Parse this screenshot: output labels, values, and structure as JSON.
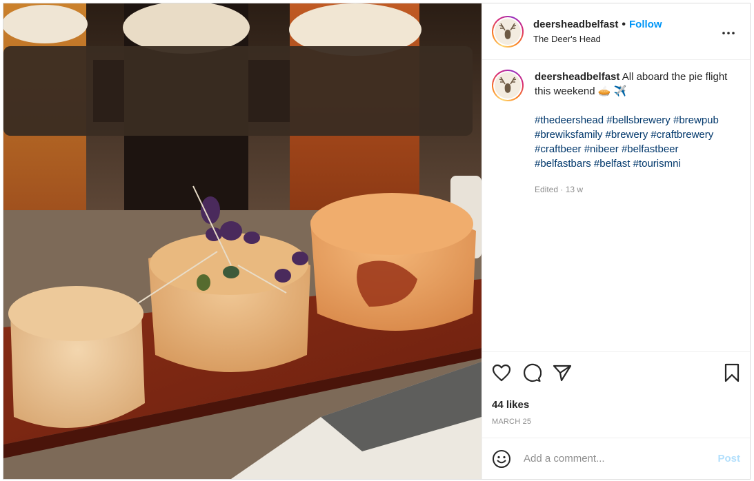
{
  "post": {
    "username": "deersheadbelfast",
    "separator": "•",
    "follow_label": "Follow",
    "location": "The Deer's Head",
    "caption_text": "All aboard the pie flight this weekend",
    "caption_emoji": "🥧 ✈️",
    "hashtags": [
      "#thedeershead",
      "#bellsbrewery",
      "#brewpub",
      "#brewiksfamily",
      "#brewery",
      "#craftbrewery",
      "#craftbeer",
      "#nibeer",
      "#belfastbeer",
      "#belfastbars",
      "#belfast",
      "#tourismni"
    ],
    "edited_label": "Edited",
    "meta_separator": "·",
    "time_ago": "13 w",
    "likes": "44 likes",
    "date": "MARCH 25"
  },
  "comment": {
    "placeholder": "Add a comment...",
    "post_label": "Post"
  },
  "colors": {
    "accent": "#0095f6",
    "hashtag": "#00376b",
    "muted": "#8e8e8e",
    "post_disabled": "#b2dffc"
  },
  "icons": {
    "more": "more-options-icon",
    "like": "heart-icon",
    "comment": "comment-icon",
    "share": "share-icon",
    "save": "bookmark-icon",
    "emoji": "emoji-icon",
    "avatar": "deer-logo-icon"
  }
}
